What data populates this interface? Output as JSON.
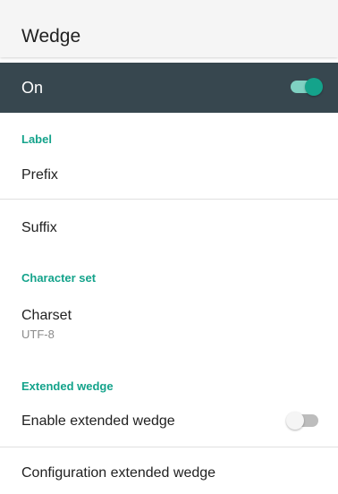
{
  "app_bar": {
    "title": "Wedge"
  },
  "master_switch": {
    "label": "On",
    "checked": true
  },
  "sections": {
    "label": {
      "header": "Label",
      "prefix": "Prefix",
      "suffix": "Suffix"
    },
    "character_set": {
      "header": "Character set",
      "charset_title": "Charset",
      "charset_value": "UTF-8"
    },
    "extended_wedge": {
      "header": "Extended wedge",
      "enable_title": "Enable extended wedge",
      "enable_checked": false,
      "config_title": "Configuration extended wedge"
    }
  },
  "colors": {
    "accent": "#14a38b",
    "master_bar": "#37474f",
    "switch_on_track": "#7fd1c2",
    "switch_on_thumb": "#14a38b",
    "switch_off_track": "#bdbdbd",
    "switch_off_thumb": "#f5f5f5"
  }
}
